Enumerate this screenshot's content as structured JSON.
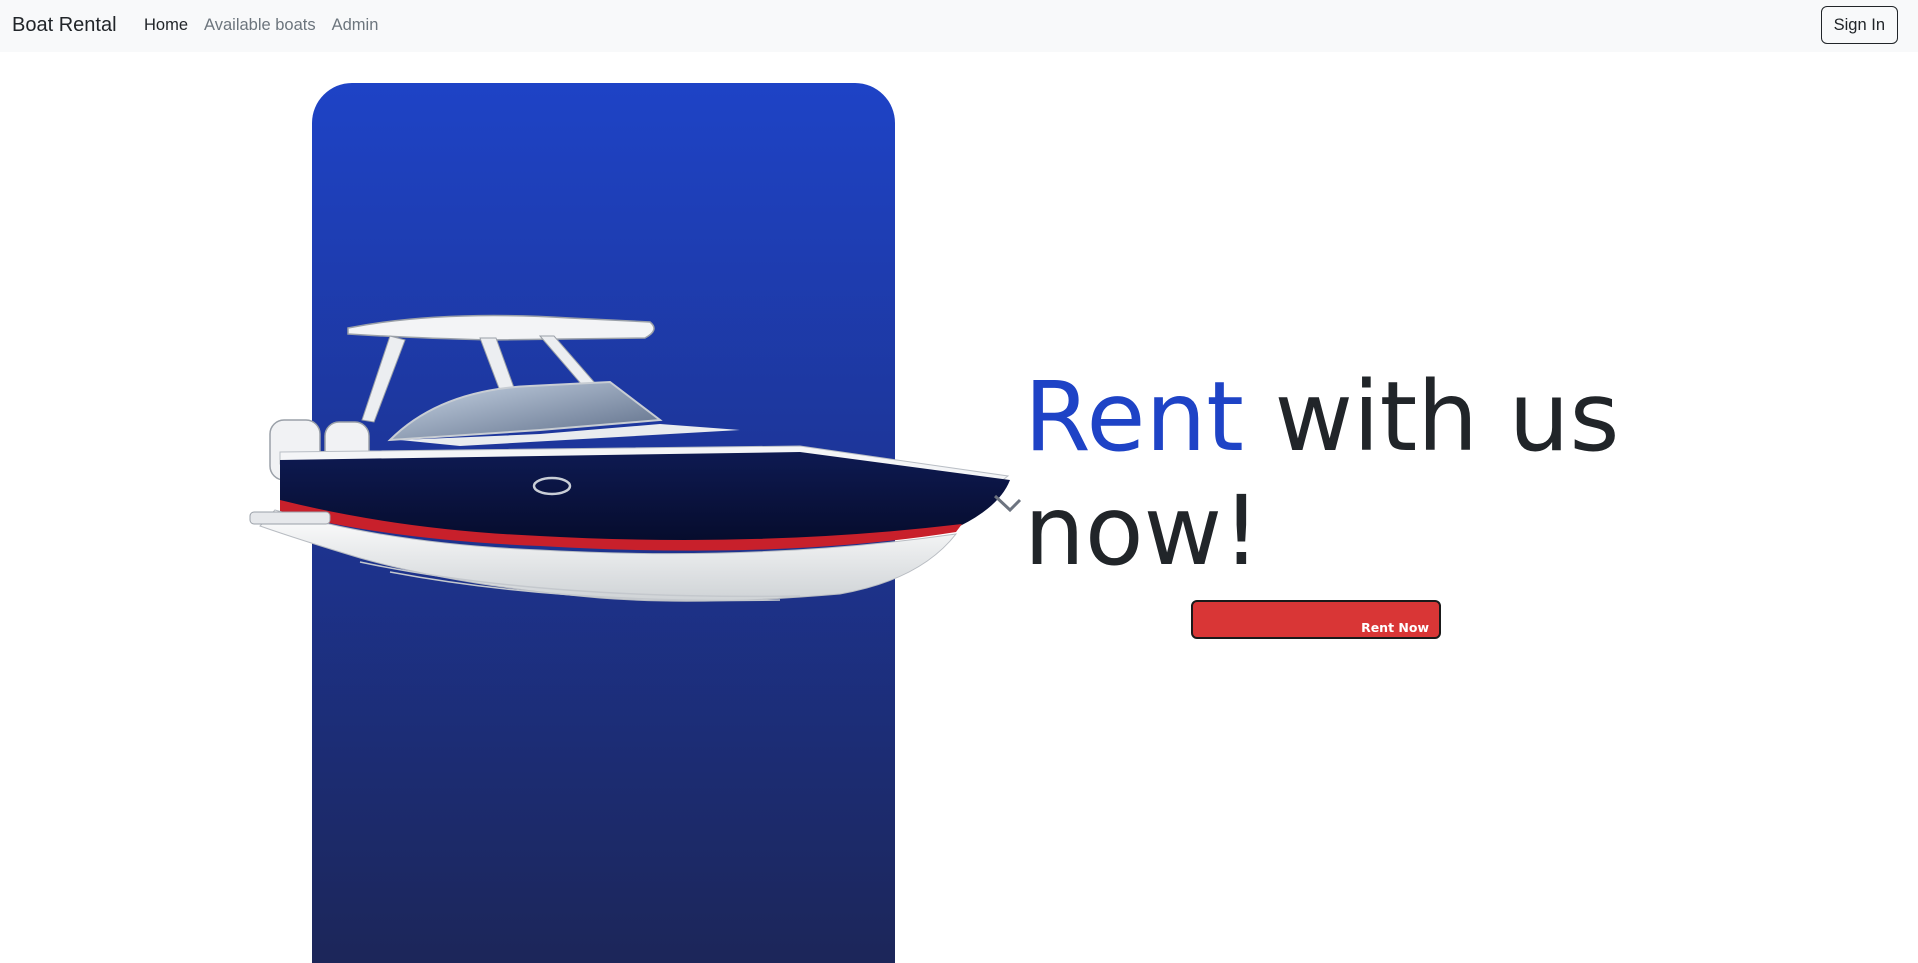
{
  "navbar": {
    "brand": "Boat Rental",
    "links": [
      {
        "label": "Home",
        "active": true
      },
      {
        "label": "Available boats",
        "active": false
      },
      {
        "label": "Admin",
        "active": false
      }
    ],
    "signin_label": "Sign In"
  },
  "hero": {
    "headline_accent": "Rent",
    "headline_rest": " with us now!",
    "cta_label": "Rent Now",
    "image": "boat-image"
  },
  "colors": {
    "accent_blue": "#1e43c6",
    "cta_red": "#d93636",
    "navbar_bg": "#f8f9fa",
    "text_dark": "#212529"
  }
}
